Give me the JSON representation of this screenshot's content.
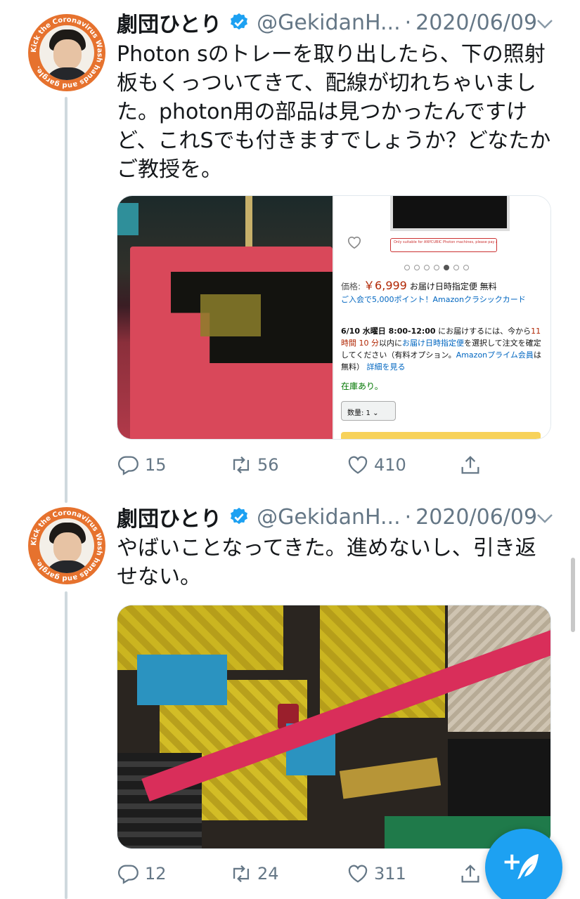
{
  "tweets": [
    {
      "name": "劇団ひとり",
      "handle": "@GekidanH...",
      "separator": "·",
      "date": "2020/06/09",
      "avatar_ring_text": "Kick the Coronavirus Wash hands and gargle.",
      "text_lines": [
        "Photon sのトレーを取り出したら、下の照射",
        "板もくっついてきて、配線が切れちゃいまし",
        "た。photon用の部品は見つかったんですけ",
        "ど、これSでも付きますでしょうか？どなたか",
        "ご教授を。"
      ],
      "listing": {
        "warning_text": "Only suitable for ANYCUBIC Photon machines, please pay attention to the screen size.",
        "price_label": "価格:",
        "price_value": "￥6,999",
        "price_note": "お届け日時指定便 無料",
        "promo": "ご入会で5,000ポイント！Amazonクラシックカード",
        "delivery": {
          "date": "6/10 水曜日 8:00-12:00",
          "line1": "にお届けするには、今から",
          "countdown": "11 時間 10 分",
          "within": "以内に",
          "link1": "お届け日時指定便",
          "line2": "を選択して注文を確定してください（有料オプション。",
          "link2": "Amazonプライム会員",
          "line3": "は無料）",
          "link3": "詳細を見る"
        },
        "stock": "在庫あり。",
        "qty": "数量: 1",
        "gallery_dots": 7,
        "gallery_active": 5
      },
      "counts": {
        "reply": "15",
        "retweet": "56",
        "like": "410"
      }
    },
    {
      "name": "劇団ひとり",
      "handle": "@GekidanH...",
      "separator": "·",
      "date": "2020/06/09",
      "avatar_ring_text": "Kick the Coronavirus Wash hands and gargle.",
      "text_lines": [
        "やばいことなってきた。進めないし、引き返",
        "せない。"
      ],
      "counts": {
        "reply": "12",
        "retweet": "24",
        "like": "311"
      }
    }
  ],
  "icons": {
    "verified": "verified-badge-icon",
    "chevron": "chevron-down-icon",
    "reply": "reply-icon",
    "retweet": "retweet-icon",
    "like": "heart-icon",
    "share": "share-icon",
    "compose": "compose-tweet-icon"
  },
  "colors": {
    "accent": "#1da1f2",
    "secondary_text": "#657786",
    "avatar_ring": "#e6722e"
  }
}
